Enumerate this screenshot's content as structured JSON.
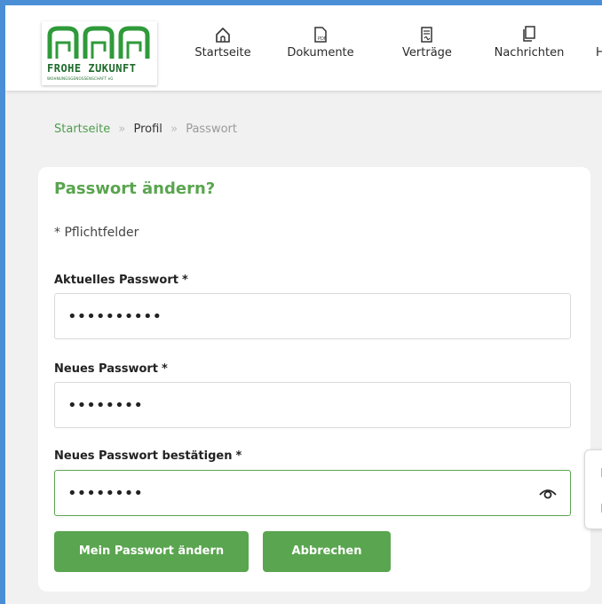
{
  "brand": {
    "name": "FROHE ZUKUNFT",
    "sub": "WOHNUNGSGENOSSENSCHAFT eG",
    "color": "#1f6b2c"
  },
  "nav": [
    {
      "label": "Startseite",
      "icon": "home-icon"
    },
    {
      "label": "Dokumente",
      "icon": "pdf-document-icon"
    },
    {
      "label": "Verträge",
      "icon": "contract-icon"
    },
    {
      "label": "Nachrichten",
      "icon": "messages-icon"
    },
    {
      "label": "H",
      "icon": "more-icon"
    }
  ],
  "breadcrumb": {
    "home": "Startseite",
    "sep": "»",
    "profile": "Profil",
    "current": "Passwort"
  },
  "form": {
    "title": "Passwort ändern?",
    "required_note": "* Pflichtfelder",
    "current_label": "Aktuelles Passwort",
    "current_value": "••••••••••",
    "new_label": "Neues Passwort",
    "new_value": "••••••••",
    "confirm_label": "Neues Passwort bestätigen",
    "confirm_value": "••••••••",
    "star": "*"
  },
  "buttons": {
    "submit": "Mein Passwort ändern",
    "cancel": "Abbrechen"
  },
  "colors": {
    "accent": "#5aa54f",
    "frame": "#4a8fd6"
  }
}
